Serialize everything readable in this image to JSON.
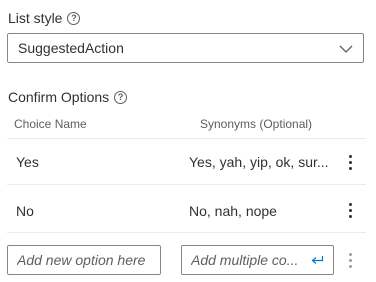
{
  "list_style": {
    "label": "List style",
    "selected_value": "SuggestedAction"
  },
  "confirm_options": {
    "label": "Confirm Options",
    "columns": {
      "choice": "Choice Name",
      "synonyms": "Synonyms (Optional)"
    },
    "rows": [
      {
        "choice": "Yes",
        "synonyms": "Yes, yah, yip, ok, sur..."
      },
      {
        "choice": "No",
        "synonyms": "No, nah, nope"
      }
    ],
    "new_option_placeholder": "Add new option here",
    "multiple_placeholder": "Add multiple co..."
  },
  "icons": {
    "info": "info-icon",
    "dropdown": "chevron-down-icon",
    "more": "more-vertical-icon",
    "enter": "enter-return-icon"
  },
  "colors": {
    "border": "#8a8886",
    "accent": "#0078d4",
    "divider": "#edebe9"
  }
}
